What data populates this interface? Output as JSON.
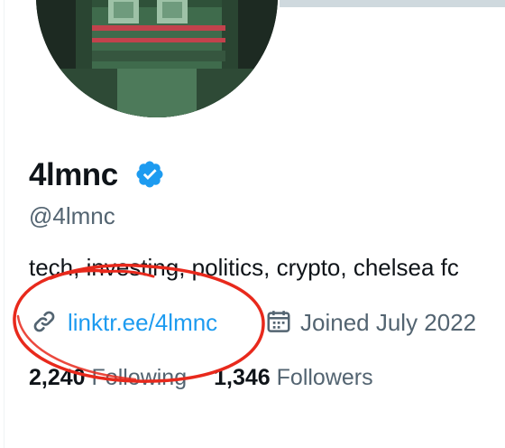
{
  "profile": {
    "display_name": "4lmnc",
    "handle": "@4lmnc",
    "bio": "tech, investing, politics, crypto, chelsea fc",
    "link_text": "linktr.ee/4lmnc",
    "joined": "Joined July 2022"
  },
  "stats": {
    "following_count": "2,240",
    "following_label": "Following",
    "followers_count": "1,346",
    "followers_label": "Followers"
  },
  "icons": {
    "verified": "verified-badge-icon",
    "link": "link-icon",
    "calendar": "calendar-icon"
  },
  "colors": {
    "accent": "#1d9bf0",
    "text": "#0f1419",
    "secondary": "#536471",
    "annotation": "#e8291c"
  }
}
